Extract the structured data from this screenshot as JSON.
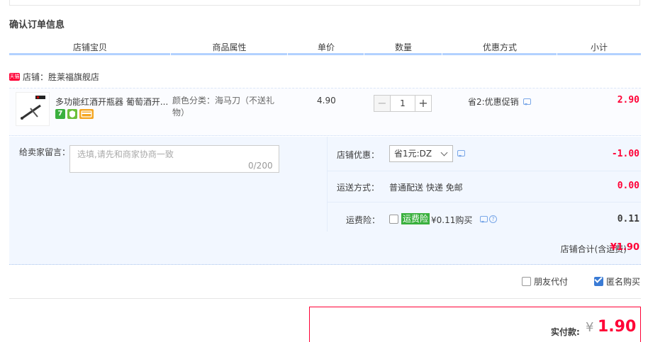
{
  "title": "确认订单信息",
  "columns": [
    "店铺宝贝",
    "商品属性",
    "单价",
    "数量",
    "优惠方式",
    "小计"
  ],
  "shop": {
    "badge": "天猫",
    "label": "店铺：胜莱福旗舰店"
  },
  "item": {
    "title": "多功能红酒开瓶器 葡萄酒开...",
    "services": {
      "seven": "7"
    },
    "sku_line1": "颜色分类：海马刀（不送礼",
    "sku_line2": "物）",
    "unit_price": "4.90",
    "quantity": "1",
    "qty_minus": "−",
    "qty_plus": "+",
    "promotion": "省2:优惠促销",
    "subtotal": "2.90"
  },
  "message": {
    "label": "给卖家留言：",
    "placeholder": "选填,请先和商家协商一致",
    "count": "0/200"
  },
  "shop_discount": {
    "label": "店铺优惠：",
    "selected": "省1元:DZ",
    "amount": "-1.00"
  },
  "shipping": {
    "label": "运送方式：",
    "value": "普通配送 快递 免邮",
    "amount": "0.00"
  },
  "insurance": {
    "label": "运费险：",
    "badge": "运费险",
    "value": "¥0.11购买",
    "help": "?",
    "amount": "0.11"
  },
  "shop_total": {
    "label": "店铺合计(含运费)",
    "amount": "¥1.90"
  },
  "options": {
    "friend_pay": "朋友代付",
    "anonymous": "匿名购买",
    "anonymous_checked": true
  },
  "payment": {
    "label": "实付款:",
    "currency": "¥",
    "amount": "1.90"
  },
  "colors": {
    "accent_red": "#ff0036",
    "header_rule": "#b2d1ff",
    "panel_bg": "#f2f7ff",
    "check_blue": "#3a7bd5",
    "insurance_green": "#3ab03e"
  }
}
